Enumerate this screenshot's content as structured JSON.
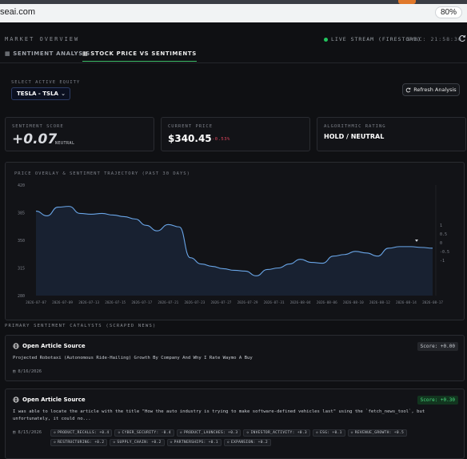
{
  "browser": {
    "url": "seai.com",
    "zoom": "80%"
  },
  "header": {
    "title": "MARKET OVERVIEW",
    "live": "LIVE STREAM (FIRESTORE)",
    "sync": "SYNC: 21:58:30"
  },
  "tabs": [
    {
      "label": "SENTIMENT ANALYSIS",
      "icon": "chart-icon",
      "active": false
    },
    {
      "label": "STOCK PRICE VS SENTIMENTS",
      "icon": "chart-icon",
      "active": true
    }
  ],
  "equity": {
    "label": "SELECT ACTIVE EQUITY",
    "selected": "TESLA - TSLA"
  },
  "refresh_button": "Refresh Analysis",
  "cards": {
    "sentiment": {
      "label": "SENTIMENT SCORE",
      "value": "+0.07",
      "sub": "NEUTRAL"
    },
    "price": {
      "label": "CURRENT PRICE",
      "value": "$340.45",
      "change": "-0.53%"
    },
    "rating": {
      "label": "ALGORITHMIC RATING",
      "value": "HOLD / NEUTRAL"
    }
  },
  "chart_data": {
    "type": "line",
    "title": "PRICE OVERLAY & SENTIMENT TRAJECTORY (PAST 30 DAYS)",
    "x_ticks": [
      "2026-07-07",
      "2026-07-09",
      "2026-07-13",
      "2026-07-15",
      "2026-07-17",
      "2026-07-21",
      "2026-07-23",
      "2026-07-27",
      "2026-07-29",
      "2026-07-31",
      "2026-08-04",
      "2026-08-06",
      "2026-08-10",
      "2026-08-12",
      "2026-08-14",
      "2026-08-17"
    ],
    "y_left_ticks": [
      "420",
      "385",
      "350",
      "315",
      "280"
    ],
    "ylim_left": [
      280,
      420
    ],
    "y_right_ticks": [
      "1",
      "0.5",
      "0",
      "-0.5",
      "-1"
    ],
    "series": [
      {
        "values": [
          387,
          381,
          392,
          393,
          384,
          383,
          384,
          382,
          380,
          377,
          369,
          362,
          370,
          367,
          328,
          320,
          317,
          314,
          312,
          311,
          305,
          313,
          315,
          320,
          326,
          322,
          321,
          330,
          332,
          336,
          334,
          330,
          340,
          342,
          342,
          341,
          340
        ]
      }
    ]
  },
  "catalysts": {
    "title": "PRIMARY SENTIMENT CATALYSTS (SCRAPED NEWS)",
    "items": [
      {
        "link": "Open Article Source",
        "score": "Score: +0.00",
        "text": "Projected Robotaxi (Autonomous Ride-Hailing) Growth By Company And Why I Rate Waymo A Buy",
        "date": "8/16/2026",
        "chips": []
      },
      {
        "link": "Open Article Source",
        "score": "Score: +0.30",
        "text": "I was able to locate the article with the title \"How the auto industry is trying to make software-defined vehicles last\" using the `fetch_news_tool`, but unfortunately, it could no...",
        "date": "8/15/2026",
        "chips": [
          "PRODUCT_RECALLS: +0.4",
          "CYBER_SECURITY: -0.4",
          "PRODUCT_LAUNCHES: +0.3",
          "INVESTOR_ACTIVITY: +0.3",
          "ESG: +0.1",
          "REVENUE_GROWTH: +0.5",
          "RESTRUCTURING: +0.2",
          "SUPPLY_CHAIN: +0.2",
          "PARTNERSHIPS: +0.1",
          "EXPANSION: +0.2"
        ]
      }
    ]
  }
}
